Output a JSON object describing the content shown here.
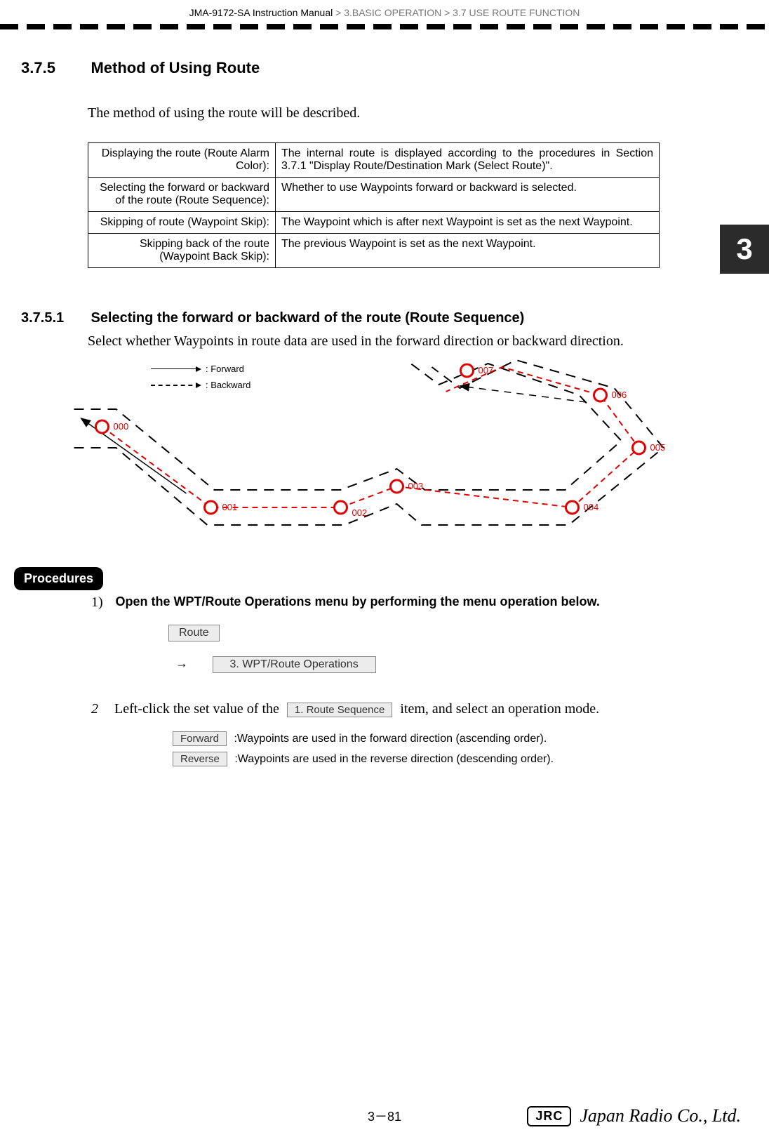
{
  "header": {
    "manual": "JMA-9172-SA Instruction Manual",
    "crumb2": "3.BASIC OPERATION",
    "crumb3": "3.7  USE ROUTE FUNCTION",
    "sep": ">"
  },
  "chapterTab": "3",
  "section": {
    "num": "3.7.5",
    "title": "Method of Using Route",
    "intro": "The method of using the route will be described."
  },
  "table": {
    "rows": [
      {
        "left": "Displaying the route (Route Alarm Color):",
        "right": "The internal route is displayed according to the procedures in Section 3.7.1 \"Display Route/Destination Mark (Select Route)\"."
      },
      {
        "left": "Selecting the forward or backward of the route (Route Sequence):",
        "right": "Whether to use Waypoints forward or backward is selected."
      },
      {
        "left": "Skipping of route (Waypoint Skip):",
        "right": "The Waypoint which is after next Waypoint is set as the next Waypoint."
      },
      {
        "left": "Skipping back of the route (Waypoint Back Skip):",
        "right": "The previous Waypoint is set as the next Waypoint."
      }
    ]
  },
  "subsection": {
    "num": "3.7.5.1",
    "title": "Selecting the forward or backward of the route (Route Sequence)",
    "intro": "Select whether Waypoints in route data are used in the forward direction or backward direction."
  },
  "diagram": {
    "legend_forward": ": Forward",
    "legend_backward": ": Backward",
    "waypoints": [
      "000",
      "001",
      "002",
      "003",
      "004",
      "005",
      "006",
      "007"
    ]
  },
  "procedures": {
    "label": "Procedures",
    "step1_num": "1)",
    "step1_text": "Open the WPT/Route Operations menu by performing the menu operation below.",
    "menu_route": "Route",
    "arrow": "→",
    "menu_wpt": "3. WPT/Route Operations",
    "step2_num": "2",
    "step2_pre": "Left-click the set value of the ",
    "step2_btn": "1. Route Sequence",
    "step2_post": " item, and select an operation mode.",
    "opt_forward": "Forward",
    "opt_forward_desc": ":Waypoints are used in the forward direction (ascending order).",
    "opt_reverse": "Reverse",
    "opt_reverse_desc": ":Waypoints are used in the reverse direction (descending order)."
  },
  "footer": {
    "pagenum": "3－81",
    "brand_box": "JRC",
    "brand_script": "Japan Radio Co., Ltd."
  }
}
